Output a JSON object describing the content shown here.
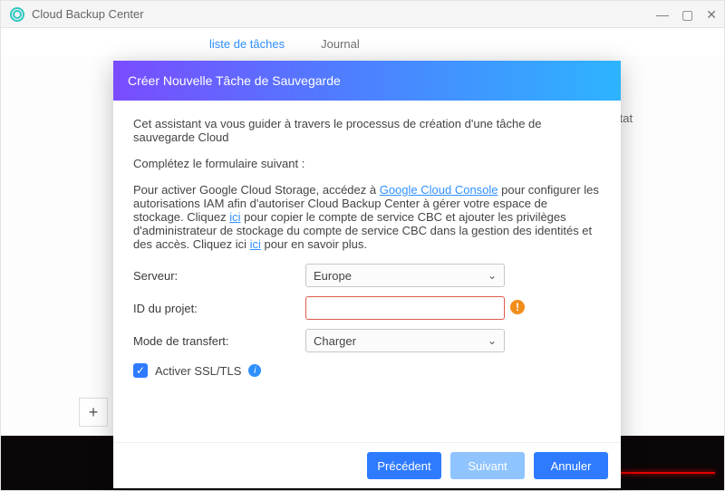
{
  "window": {
    "app_title": "Cloud Backup Center"
  },
  "tabs": {
    "tasks": "liste de tâches",
    "journal": "Journal"
  },
  "background": {
    "state_column": "Etat"
  },
  "modal": {
    "title": "Créer Nouvelle Tâche de Sauvegarde",
    "intro": "Cet assistant va vous guider à travers le processus de création d'une tâche de sauvegarde Cloud",
    "complete_prompt": "Complétez le formulaire suivant :",
    "help_prefix": "Pour activer Google Cloud Storage, accédez à ",
    "help_link1": "Google Cloud Console",
    "help_mid1": " pour configurer les autorisations IAM afin d'autoriser Cloud Backup Center à gérer votre espace de stockage. Cliquez ",
    "help_link2": "ici",
    "help_mid2": " pour copier le compte de service CBC et ajouter les privilèges d'administrateur de stockage du compte de service CBC dans la gestion des identités et des accès. Cliquez ici ",
    "help_link3": "ici",
    "help_suffix": " pour en savoir plus.",
    "labels": {
      "server": "Serveur:",
      "project_id": "ID du projet:",
      "transfer_mode": "Mode de transfert:",
      "ssl": "Activer SSL/TLS"
    },
    "values": {
      "server": "Europe",
      "project_id": "",
      "transfer_mode": "Charger",
      "ssl_checked": true
    },
    "buttons": {
      "prev": "Précédent",
      "next": "Suivant",
      "cancel": "Annuler"
    }
  }
}
